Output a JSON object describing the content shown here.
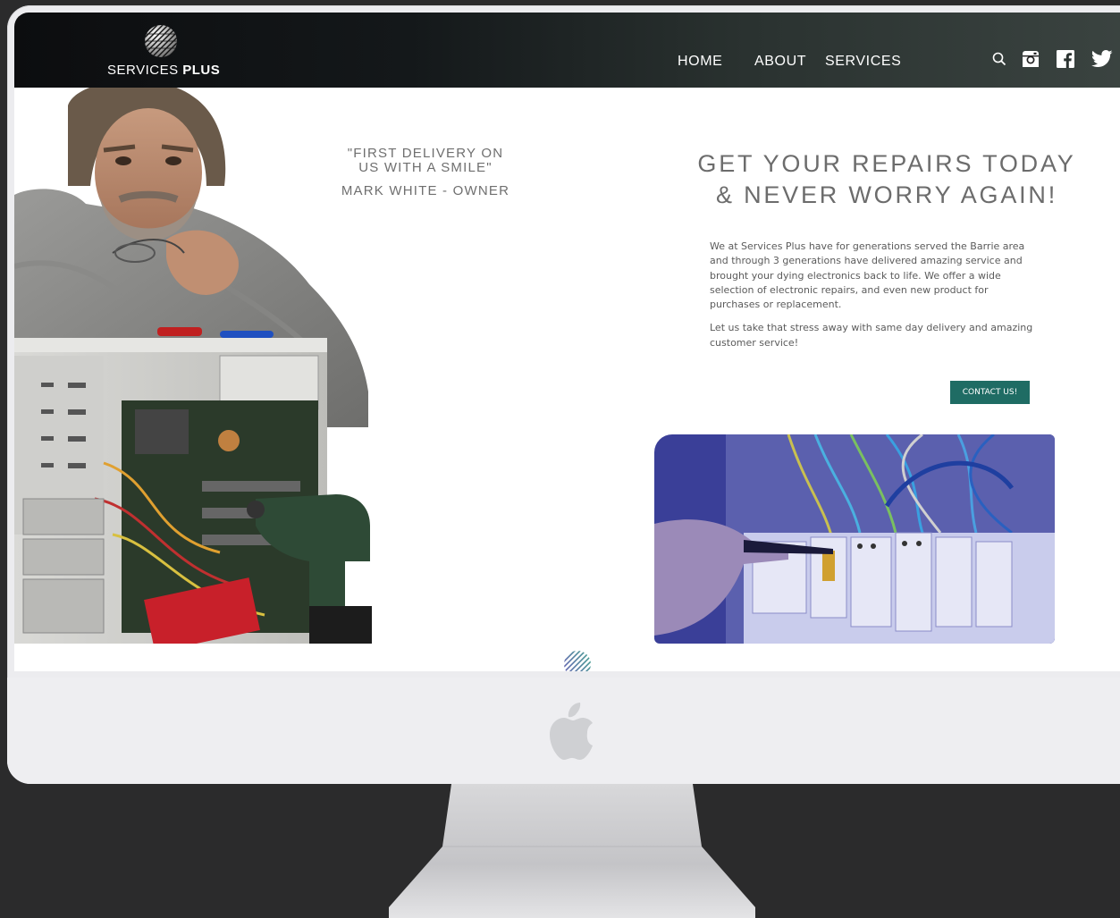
{
  "brand": {
    "name_light": "SERVICES ",
    "name_bold": "PLUS"
  },
  "nav": {
    "items": [
      {
        "label": "HOME"
      },
      {
        "label": "ABOUT"
      },
      {
        "label": "SERVICES"
      }
    ]
  },
  "header_icons": [
    "search-icon",
    "instagram-icon",
    "facebook-icon",
    "twitter-icon"
  ],
  "quote": {
    "text_line1": "\"FIRST DELIVERY ON",
    "text_line2": "US WITH A SMILE\"",
    "author": "MARK WHITE - OWNER"
  },
  "hero": {
    "headline_line1": "GET YOUR REPAIRS TODAY",
    "headline_line2": "& NEVER WORRY AGAIN!",
    "paragraph1": "We at Services Plus have for generations served the Barrie area and through 3 generations have delivered amazing service and brought your dying electronics back to life. We offer a wide selection of electronic repairs, and even new product for purchases or replacement.",
    "paragraph2": "Let us take that stress away with same day delivery and amazing customer service!",
    "cta_label": "CONTACT US!"
  },
  "colors": {
    "accent": "#1f6c64",
    "header_dark": "#0c0d0f",
    "header_light": "#3b4441",
    "headline_gray": "#6c6c6c",
    "panel_overlay": "#2a2f8f"
  }
}
